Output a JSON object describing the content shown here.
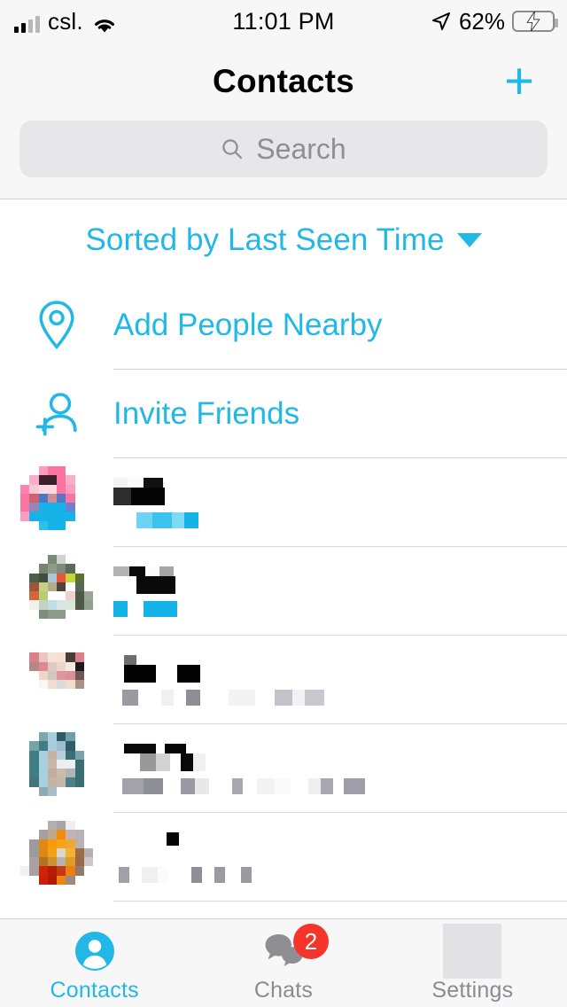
{
  "status_bar": {
    "carrier": "csl.",
    "time": "11:01 PM",
    "battery_percent": "62%",
    "battery_level": 62,
    "charging": true,
    "wifi_icon": "wifi-icon",
    "signal_icon": "cellular-signal-icon",
    "location_icon": "location-arrow-icon"
  },
  "header": {
    "title": "Contacts",
    "add_label": "+"
  },
  "search": {
    "placeholder": "Search",
    "value": "",
    "icon": "search-icon"
  },
  "sort": {
    "label": "Sorted by Last Seen Time",
    "caret_icon": "chevron-down-icon"
  },
  "actions": [
    {
      "label": "Add People Nearby",
      "icon": "location-pin-icon"
    },
    {
      "label": "Invite Friends",
      "icon": "add-person-icon"
    }
  ],
  "contacts": [
    {
      "name": "",
      "status": "",
      "redacted": true,
      "avatar_colors": [
        "#ffffff",
        "#ffffff",
        "#fb9cc0",
        "#f9759f",
        "#f9759f",
        "#ffffff",
        "#ffffff",
        "#ffffff",
        "#ffffff",
        "#fbadcb",
        "#3c1f28",
        "#3c1f28",
        "#f9759f",
        "#fbadcb",
        "#ffffff",
        "#ffffff",
        "#fb84ad",
        "#fbc6d8",
        "#fbd8e2",
        "#fbd8e2",
        "#f9759f",
        "#fb9cc0",
        "#ffffff",
        "#ffffff",
        "#f9759f",
        "#cf6270",
        "#4a76c8",
        "#cf8c92",
        "#5478c6",
        "#f9759f",
        "#ffffff",
        "#ffffff",
        "#f9759f",
        "#9b83bb",
        "#16b3e8",
        "#16b3e8",
        "#16b3e8",
        "#6d7fd0",
        "#ffffff",
        "#ffffff",
        "#fb9cc0",
        "#16b3e8",
        "#16b3e8",
        "#16b3e8",
        "#16b3e8",
        "#16b3e8",
        "#ffffff",
        "#ffffff",
        "#ffffff",
        "#ffffff",
        "#2cc0ea",
        "#16b3e8",
        "#16b3e8",
        "#ffffff",
        "#ffffff",
        "#ffffff",
        "#ffffff",
        "#ffffff",
        "#ffffff",
        "#ffffff",
        "#ffffff",
        "#ffffff",
        "#ffffff",
        "#ffffff"
      ],
      "name_blocks": [
        {
          "w": 16,
          "c": "#f4f4f4"
        },
        {
          "w": 18,
          "c": "#fbfbfb"
        },
        {
          "w": 22,
          "c": "#111111"
        },
        {
          "w": 0,
          "c": "#ffffff"
        }
      ],
      "name_blocks2": [
        {
          "w": 20,
          "c": "#2e2e2e"
        },
        {
          "w": 38,
          "c": "#050505"
        }
      ],
      "sub_blocks": [
        {
          "w": 26,
          "c": "#ffffff"
        },
        {
          "w": 18,
          "c": "#6fd4f2"
        },
        {
          "w": 22,
          "c": "#39c3ee"
        },
        {
          "w": 14,
          "c": "#7ddaf4"
        },
        {
          "w": 16,
          "c": "#16b3e8"
        }
      ]
    },
    {
      "name": "",
      "status": "",
      "redacted": true,
      "avatar_colors": [
        "#ffffff",
        "#ffffff",
        "#ffffff",
        "#7b8a77",
        "#cfd3cd",
        "#ffffff",
        "#ffffff",
        "#ffffff",
        "#ffffff",
        "#ffffff",
        "#77856f",
        "#8f9a88",
        "#7e8a78",
        "#5b6a58",
        "#ffffff",
        "#ffffff",
        "#ffffff",
        "#4e5c4b",
        "#3f4c3e",
        "#a8c6d8",
        "#e8553a",
        "#c4d73a",
        "#5f7034",
        "#ffffff",
        "#ffffff",
        "#a0543b",
        "#c9cf86",
        "#b6ab86",
        "#4e443c",
        "#ffffff",
        "#586652",
        "#ffffff",
        "#ffffff",
        "#d2663a",
        "#b7cf72",
        "#ffffff",
        "#ffffff",
        "#f2cfd2",
        "#4d5a48",
        "#9aa695",
        "#ffffff",
        "#eef2ec",
        "#c3d3c6",
        "#c3dce8",
        "#d7e6e3",
        "#d9e6da",
        "#4d5a48",
        "#93a090",
        "#ffffff",
        "#ffffff",
        "#7f8d7b",
        "#8d9a88",
        "#8d9a88",
        "#ffffff",
        "#ffffff",
        "#ffffff",
        "#ffffff",
        "#ffffff",
        "#ffffff",
        "#ffffff",
        "#ffffff",
        "#ffffff",
        "#ffffff",
        "#ffffff"
      ],
      "name_blocks": [
        {
          "w": 18,
          "c": "#b3b3b3"
        },
        {
          "w": 18,
          "c": "#0a0a0a"
        },
        {
          "w": 16,
          "c": "#fcfcfc"
        },
        {
          "w": 16,
          "c": "#a6a6a6"
        }
      ],
      "name_blocks2": [
        {
          "w": 26,
          "c": "#ffffff"
        },
        {
          "w": 22,
          "c": "#0a0a0a"
        },
        {
          "w": 22,
          "c": "#0a0a0a"
        }
      ],
      "sub_blocks": [
        {
          "w": 16,
          "c": "#16b3e8"
        },
        {
          "w": 18,
          "c": "#ffffff"
        },
        {
          "w": 22,
          "c": "#16b3e8"
        },
        {
          "w": 16,
          "c": "#16b3e8"
        }
      ]
    },
    {
      "name": "",
      "status": "",
      "redacted": true,
      "avatar_colors": [
        "#ffffff",
        "#ffffff",
        "#ffffff",
        "#ffffff",
        "#ffffff",
        "#ffffff",
        "#ffffff",
        "#ffffff",
        "#ffffff",
        "#d9808a",
        "#ecc4c0",
        "#f4e3d6",
        "#f3e2d4",
        "#4a3c38",
        "#d9808a",
        "#ffffff",
        "#ffffff",
        "#b08a86",
        "#e08891",
        "#ddcac2",
        "#edd5c9",
        "#f6eae0",
        "#1c1a1a",
        "#ffffff",
        "#ffffff",
        "#ffffff",
        "#ecd6c8",
        "#d4c6bc",
        "#e3949b",
        "#dd8f97",
        "#6d5a56",
        "#ffffff",
        "#ffffff",
        "#ffffff",
        "#fbf6f2",
        "#f2ddd2",
        "#d6dbdd",
        "#f0ddcb",
        "#ab9289",
        "#ffffff",
        "#ffffff",
        "#ffffff",
        "#ffffff",
        "#ffffff",
        "#ffffff",
        "#ffffff",
        "#ffffff",
        "#ffffff",
        "#ffffff",
        "#ffffff",
        "#ffffff",
        "#ffffff",
        "#ffffff",
        "#ffffff",
        "#ffffff",
        "#ffffff",
        "#ffffff",
        "#ffffff",
        "#ffffff",
        "#ffffff",
        "#ffffff",
        "#ffffff",
        "#ffffff",
        "#ffffff"
      ],
      "name_blocks": [
        {
          "w": 12,
          "c": "#ffffff"
        },
        {
          "w": 14,
          "c": "#6e6e6e"
        },
        {
          "w": 28,
          "c": "#ffffff"
        }
      ],
      "name_blocks2": [
        {
          "w": 12,
          "c": "#ffffff"
        },
        {
          "w": 36,
          "c": "#030303"
        },
        {
          "w": 24,
          "c": "#ffffff"
        },
        {
          "w": 26,
          "c": "#030303"
        }
      ],
      "sub_blocks": [
        {
          "w": 10,
          "c": "#ffffff"
        },
        {
          "w": 18,
          "c": "#9a9aa0"
        },
        {
          "w": 26,
          "c": "#ffffff"
        },
        {
          "w": 14,
          "c": "#f0f0f2"
        },
        {
          "w": 14,
          "c": "#ffffff"
        },
        {
          "w": 16,
          "c": "#8e8e96"
        },
        {
          "w": 32,
          "c": "#ffffff"
        },
        {
          "w": 30,
          "c": "#f3f3f5"
        },
        {
          "w": 22,
          "c": "#ffffff"
        },
        {
          "w": 20,
          "c": "#c2c2c8"
        },
        {
          "w": 14,
          "c": "#f2f2f4"
        },
        {
          "w": 22,
          "c": "#c8c8ce"
        }
      ]
    },
    {
      "name": "",
      "status": "",
      "redacted": true,
      "avatar_colors": [
        "#ffffff",
        "#ffffff",
        "#7fa6ac",
        "#a9cde0",
        "#2f5c5e",
        "#6f9fa8",
        "#ffffff",
        "#ffffff",
        "#ffffff",
        "#75a4a6",
        "#3f7d82",
        "#a5ccdf",
        "#9dbed0",
        "#2d5f66",
        "#ffffff",
        "#ffffff",
        "#ffffff",
        "#3e7e84",
        "#a9cfe2",
        "#c6b3a4",
        "#b9cfdd",
        "#3b6d74",
        "#7ba3ab",
        "#ffffff",
        "#ffffff",
        "#3e7e84",
        "#a9cfe2",
        "#c9b7a8",
        "#eceef0",
        "#eceef0",
        "#3b6d74",
        "#ffffff",
        "#ffffff",
        "#3e7e84",
        "#a9cfe2",
        "#c2ad9e",
        "#c9bcae",
        "#b0b6b4",
        "#3b6d74",
        "#ffffff",
        "#ffffff",
        "#43767c",
        "#a9cfe2",
        "#c5b4a6",
        "#c6b8aa",
        "#4d8189",
        "#3b6d74",
        "#ffffff",
        "#ffffff",
        "#ffffff",
        "#8fa8b2",
        "#a9bfc8",
        "#ffffff",
        "#ffffff",
        "#ffffff",
        "#ffffff",
        "#ffffff",
        "#ffffff",
        "#ffffff",
        "#ffffff",
        "#ffffff",
        "#ffffff",
        "#ffffff",
        "#ffffff"
      ],
      "name_blocks": [
        {
          "w": 12,
          "c": "#ffffff"
        },
        {
          "w": 36,
          "c": "#0a0a0a"
        },
        {
          "w": 10,
          "c": "#ffffff"
        },
        {
          "w": 24,
          "c": "#060606"
        }
      ],
      "name_blocks2": [
        {
          "w": 30,
          "c": "#ffffff"
        },
        {
          "w": 18,
          "c": "#999999"
        },
        {
          "w": 16,
          "c": "#d2d2d2"
        },
        {
          "w": 12,
          "c": "#ffffff"
        },
        {
          "w": 14,
          "c": "#0a0a0a"
        },
        {
          "w": 14,
          "c": "#f0f0f0"
        }
      ],
      "sub_blocks": [
        {
          "w": 10,
          "c": "#ffffff"
        },
        {
          "w": 24,
          "c": "#a2a2a8"
        },
        {
          "w": 22,
          "c": "#8e8e96"
        },
        {
          "w": 20,
          "c": "#ffffff"
        },
        {
          "w": 16,
          "c": "#9a9aa2"
        },
        {
          "w": 16,
          "c": "#e8e8ea"
        },
        {
          "w": 26,
          "c": "#ffffff"
        },
        {
          "w": 12,
          "c": "#a8a8ae"
        },
        {
          "w": 16,
          "c": "#ffffff"
        },
        {
          "w": 20,
          "c": "#f2f2f4"
        },
        {
          "w": 18,
          "c": "#fafafa"
        },
        {
          "w": 20,
          "c": "#ffffff"
        },
        {
          "w": 14,
          "c": "#efefef"
        },
        {
          "w": 14,
          "c": "#a8a8ae"
        },
        {
          "w": 12,
          "c": "#ffffff"
        },
        {
          "w": 24,
          "c": "#9e9ea6"
        }
      ]
    },
    {
      "name": "",
      "status": "",
      "redacted": true,
      "avatar_colors": [
        "#ffffff",
        "#ffffff",
        "#ffffff",
        "#b4aeb0",
        "#aaa4a6",
        "#f0eef0",
        "#ffffff",
        "#ffffff",
        "#ffffff",
        "#ffffff",
        "#a6a0a2",
        "#c0a888",
        "#f08c10",
        "#c4b4b0",
        "#b8b2b4",
        "#ffffff",
        "#ffffff",
        "#9e9a9c",
        "#e08a14",
        "#f79b0c",
        "#f6a414",
        "#f0a830",
        "#b8b2b4",
        "#ffffff",
        "#ffffff",
        "#9e9a9c",
        "#d98812",
        "#f2a216",
        "#dcd6c8",
        "#f2b234",
        "#9c6c46",
        "#b6b0b2",
        "#ffffff",
        "#a8a2a4",
        "#ae7420",
        "#cc9430",
        "#b8b2a8",
        "#e09a2a",
        "#9a6848",
        "#cdc7c9",
        "#f2f0f2",
        "#a8a2a4",
        "#ce2408",
        "#b51c06",
        "#c23a10",
        "#ef7e12",
        "#8e7a6e",
        "#ffffff",
        "#ffffff",
        "#ffffff",
        "#c62006",
        "#b01a04",
        "#f0820e",
        "#9b8a80",
        "#ffffff",
        "#ffffff",
        "#ffffff",
        "#ffffff",
        "#ffffff",
        "#ffffff",
        "#ffffff",
        "#ffffff",
        "#ffffff",
        "#ffffff"
      ],
      "name_blocks": [
        {
          "w": 60,
          "c": "#ffffff"
        },
        {
          "w": 14,
          "c": "#050505"
        }
      ],
      "name_blocks2": [],
      "sub_blocks": [
        {
          "w": 6,
          "c": "#ffffff"
        },
        {
          "w": 12,
          "c": "#a0a0a6"
        },
        {
          "w": 14,
          "c": "#ffffff"
        },
        {
          "w": 18,
          "c": "#f0f0f2"
        },
        {
          "w": 12,
          "c": "#fbfbfb"
        },
        {
          "w": 26,
          "c": "#ffffff"
        },
        {
          "w": 12,
          "c": "#8e8e96"
        },
        {
          "w": 14,
          "c": "#ffffff"
        },
        {
          "w": 12,
          "c": "#9a9aa0"
        },
        {
          "w": 18,
          "c": "#ffffff"
        },
        {
          "w": 12,
          "c": "#9a9aa0"
        }
      ]
    }
  ],
  "tabbar": {
    "tabs": [
      {
        "label": "Contacts",
        "icon": "person-circle-icon",
        "active": true,
        "badge": null
      },
      {
        "label": "Chats",
        "icon": "chat-bubbles-icon",
        "active": false,
        "badge": "2"
      },
      {
        "label": "Settings",
        "icon": "settings-placeholder-icon",
        "active": false,
        "badge": null
      }
    ]
  },
  "colors": {
    "accent": "#21b8e8",
    "badge": "#f5342b",
    "chrome": "#f7f7f7",
    "inactive_tab": "#8b8b90",
    "separator": "#d3d3d6"
  }
}
